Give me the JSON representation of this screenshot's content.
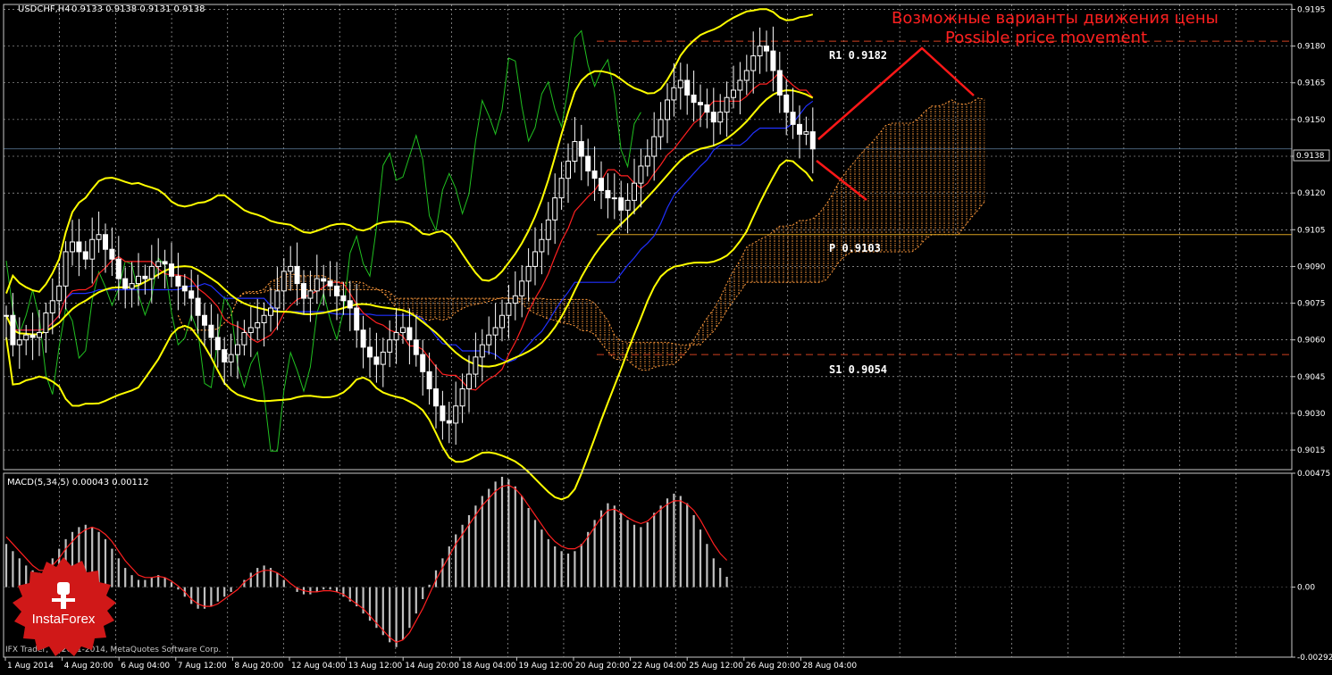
{
  "header": {
    "symbol_label": "USDCHF,H4",
    "ohlc": "0.9133 0.9138 0.9131 0.9138"
  },
  "annotations": {
    "title_ru": "Возможные варианты движения цены",
    "title_en": "Possible price movement",
    "r1": "R1 0.9182",
    "p": "P 0.9103",
    "s1": "S1 0.9054"
  },
  "macd_header": "MACD(5,34,5) 0.00043 0.00112",
  "copyright": "IFX Trader, © 2001-2014, MetaQuotes Software Corp.",
  "logo_text": "InstaForex",
  "current_price_label": "0.9138",
  "colors": {
    "background": "#000000",
    "grid": "#c8c8c8",
    "candle_up": "#ffffff",
    "candle_down": "#ffffff",
    "bollinger": "#ffff00",
    "tenkan": "#ff2020",
    "kijun": "#2030ff",
    "chikou": "#20c020",
    "kumo": "#ff9a3c",
    "pivot_line": "#d8a020",
    "annotation_text": "#ff2020",
    "macd_hist": "#c0c0c0",
    "macd_signal": "#ff2020"
  },
  "chart_data": [
    {
      "type": "candlestick",
      "symbol": "USDCHF",
      "timeframe": "H4",
      "ylim": [
        0.9007,
        0.9197
      ],
      "y_ticks": [
        "0.9195",
        "0.9180",
        "0.9165",
        "0.9150",
        "0.9135",
        "0.9120",
        "0.9105",
        "0.9090",
        "0.9075",
        "0.9060",
        "0.9045",
        "0.9030",
        "0.9015"
      ],
      "x_ticks": [
        "1 Aug 2014",
        "4 Aug 20:00",
        "6 Aug 04:00",
        "7 Aug 12:00",
        "8 Aug 20:00",
        "12 Aug 04:00",
        "13 Aug 12:00",
        "14 Aug 20:00",
        "18 Aug 04:00",
        "19 Aug 12:00",
        "20 Aug 20:00",
        "22 Aug 04:00",
        "25 Aug 12:00",
        "26 Aug 20:00",
        "28 Aug 04:00"
      ],
      "current_price": 0.9138,
      "levels": {
        "R1": 0.9182,
        "P": 0.9103,
        "S1": 0.9054
      },
      "closes": [
        0.907,
        0.9058,
        0.906,
        0.9062,
        0.9061,
        0.9063,
        0.9071,
        0.9076,
        0.9082,
        0.9096,
        0.91,
        0.9096,
        0.9093,
        0.9101,
        0.9103,
        0.9097,
        0.9093,
        0.9085,
        0.9081,
        0.9083,
        0.9086,
        0.9085,
        0.909,
        0.9092,
        0.9091,
        0.9086,
        0.9082,
        0.908,
        0.9077,
        0.907,
        0.9066,
        0.9061,
        0.9056,
        0.9051,
        0.9054,
        0.9058,
        0.9063,
        0.9065,
        0.9067,
        0.907,
        0.9073,
        0.908,
        0.9088,
        0.909,
        0.9083,
        0.9077,
        0.908,
        0.9085,
        0.9084,
        0.9082,
        0.9078,
        0.9076,
        0.9073,
        0.9064,
        0.9057,
        0.9053,
        0.905,
        0.9055,
        0.906,
        0.9063,
        0.9065,
        0.906,
        0.9054,
        0.9047,
        0.904,
        0.9033,
        0.9027,
        0.9026,
        0.9033,
        0.904,
        0.9046,
        0.9053,
        0.9058,
        0.9062,
        0.9065,
        0.907,
        0.9075,
        0.9078,
        0.9084,
        0.909,
        0.9096,
        0.9101,
        0.9109,
        0.9118,
        0.9126,
        0.9133,
        0.9141,
        0.9135,
        0.9129,
        0.9126,
        0.9121,
        0.9118,
        0.9118,
        0.9113,
        0.9117,
        0.9124,
        0.9131,
        0.9135,
        0.9143,
        0.915,
        0.9158,
        0.9163,
        0.9166,
        0.916,
        0.9157,
        0.9156,
        0.9153,
        0.9149,
        0.9153,
        0.9159,
        0.9162,
        0.9166,
        0.917,
        0.9176,
        0.918,
        0.9178,
        0.917,
        0.916,
        0.9153,
        0.9148,
        0.9144,
        0.9145,
        0.9138
      ],
      "series_names": [
        "Bollinger Bands",
        "Ichimoku Tenkan-sen",
        "Ichimoku Kijun-sen",
        "Chikou Span",
        "Kumo"
      ]
    },
    {
      "type": "bar",
      "title": "MACD(5,34,5)",
      "values_label": "0.00043 0.00112",
      "ylim": [
        -0.00292,
        0.00475
      ],
      "y_ticks": [
        "0.00475",
        "0.00",
        "-0.00292"
      ],
      "histogram": [
        0.0018,
        0.0015,
        0.0012,
        0.0009,
        0.0007,
        0.0006,
        0.0008,
        0.0012,
        0.0016,
        0.002,
        0.0023,
        0.0025,
        0.0026,
        0.0025,
        0.0023,
        0.002,
        0.0016,
        0.0012,
        0.0008,
        0.0005,
        0.0003,
        0.0003,
        0.0004,
        0.0005,
        0.0004,
        0.0002,
        -0.0001,
        -0.0004,
        -0.0007,
        -0.0009,
        -0.0009,
        -0.0008,
        -0.0006,
        -0.0004,
        -0.0002,
        0.0,
        0.0003,
        0.0006,
        0.0008,
        0.0009,
        0.0008,
        0.0006,
        0.0003,
        0.0,
        -0.0002,
        -0.0003,
        -0.0003,
        -0.0002,
        -0.0001,
        -0.0001,
        -0.0002,
        -0.0004,
        -0.0006,
        -0.0008,
        -0.0011,
        -0.0014,
        -0.0017,
        -0.002,
        -0.0023,
        -0.0025,
        -0.0022,
        -0.0017,
        -0.0011,
        -0.0005,
        0.0001,
        0.0007,
        0.0012,
        0.0017,
        0.0022,
        0.0026,
        0.003,
        0.0034,
        0.0038,
        0.0041,
        0.0044,
        0.0046,
        0.0045,
        0.0042,
        0.0038,
        0.0033,
        0.0028,
        0.0024,
        0.002,
        0.0017,
        0.0015,
        0.0014,
        0.0015,
        0.0018,
        0.0023,
        0.0028,
        0.0032,
        0.0035,
        0.0034,
        0.0031,
        0.0028,
        0.0026,
        0.0025,
        0.0027,
        0.0031,
        0.0034,
        0.0037,
        0.0039,
        0.0038,
        0.0035,
        0.003,
        0.0024,
        0.0018,
        0.0012,
        0.0008,
        0.00043
      ],
      "signal": [
        0.0021,
        0.0018,
        0.0015,
        0.0012,
        0.0009,
        0.0007,
        0.0007,
        0.0009,
        0.0012,
        0.0016,
        0.0019,
        0.0022,
        0.0024,
        0.0025,
        0.0024,
        0.0022,
        0.0019,
        0.0015,
        0.0011,
        0.0008,
        0.0005,
        0.0004,
        0.0004,
        0.00045,
        0.0004,
        0.00025,
        5e-05,
        -0.0002,
        -0.0005,
        -0.0007,
        -0.0008,
        -0.0008,
        -0.0007,
        -0.0005,
        -0.0003,
        -0.0001,
        0.0002,
        0.0004,
        0.0006,
        0.0007,
        0.0007,
        0.0006,
        0.0004,
        0.00015,
        -5e-05,
        -0.00015,
        -0.0002,
        -0.0002,
        -0.00015,
        -0.00015,
        -0.0002,
        -0.0003,
        -0.0005,
        -0.0007,
        -0.0009,
        -0.0012,
        -0.0015,
        -0.0018,
        -0.0021,
        -0.0023,
        -0.0022,
        -0.0019,
        -0.0014,
        -0.0009,
        -0.0003,
        0.0003,
        0.0008,
        0.0013,
        0.0018,
        0.0022,
        0.0026,
        0.003,
        0.0034,
        0.0037,
        0.004,
        0.0042,
        0.00425,
        0.0041,
        0.0038,
        0.0034,
        0.003,
        0.0026,
        0.0022,
        0.0019,
        0.0017,
        0.0016,
        0.0016,
        0.00175,
        0.0021,
        0.0025,
        0.0029,
        0.0032,
        0.00325,
        0.0031,
        0.0029,
        0.00275,
        0.00265,
        0.00275,
        0.003,
        0.00325,
        0.00345,
        0.0036,
        0.0036,
        0.00345,
        0.0032,
        0.0028,
        0.0023,
        0.0018,
        0.0014,
        0.00112
      ]
    }
  ]
}
